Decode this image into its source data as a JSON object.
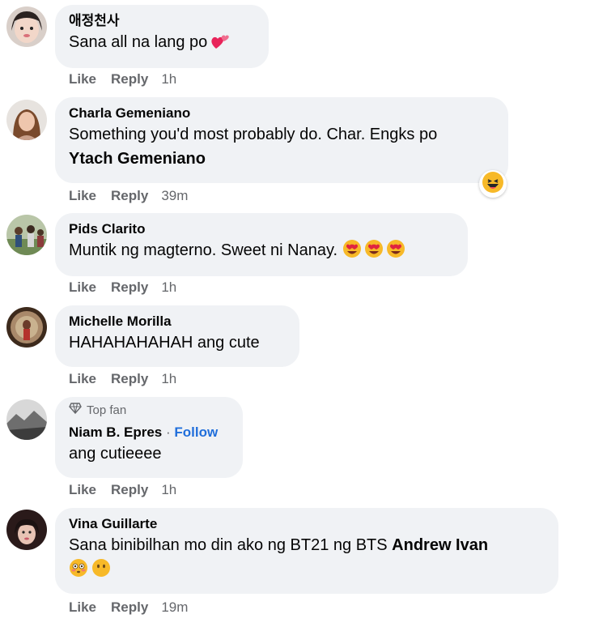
{
  "actions": {
    "like": "Like",
    "reply": "Reply"
  },
  "comments": [
    {
      "name": "애정천사",
      "text": "Sana all na lang po",
      "time": "1h",
      "emoji": "two-hearts"
    },
    {
      "name": "Charla Gemeniano",
      "text": "Something you'd most probably do. Char. Engks po",
      "mention": "Ytach Gemeniano",
      "time": "39m",
      "reaction": "laughing"
    },
    {
      "name": "Pids Clarito",
      "text": "Muntik ng magterno. Sweet ni Nanay.",
      "time": "1h",
      "emoji": "heart-eyes x3"
    },
    {
      "name": "Michelle Morilla",
      "text": "HAHAHAHAHAH ang cute",
      "time": "1h"
    },
    {
      "badge": "Top fan",
      "name": "Niam B. Epres",
      "follow": "Follow",
      "text": "ang cutieeee",
      "time": "1h"
    },
    {
      "name": "Vina Guillarte",
      "text": "Sana binibilhan mo din ako ng BT21 ng BTS",
      "mention": "Andrew Ivan",
      "time": "19m",
      "emoji": "flushed, neutral"
    }
  ]
}
